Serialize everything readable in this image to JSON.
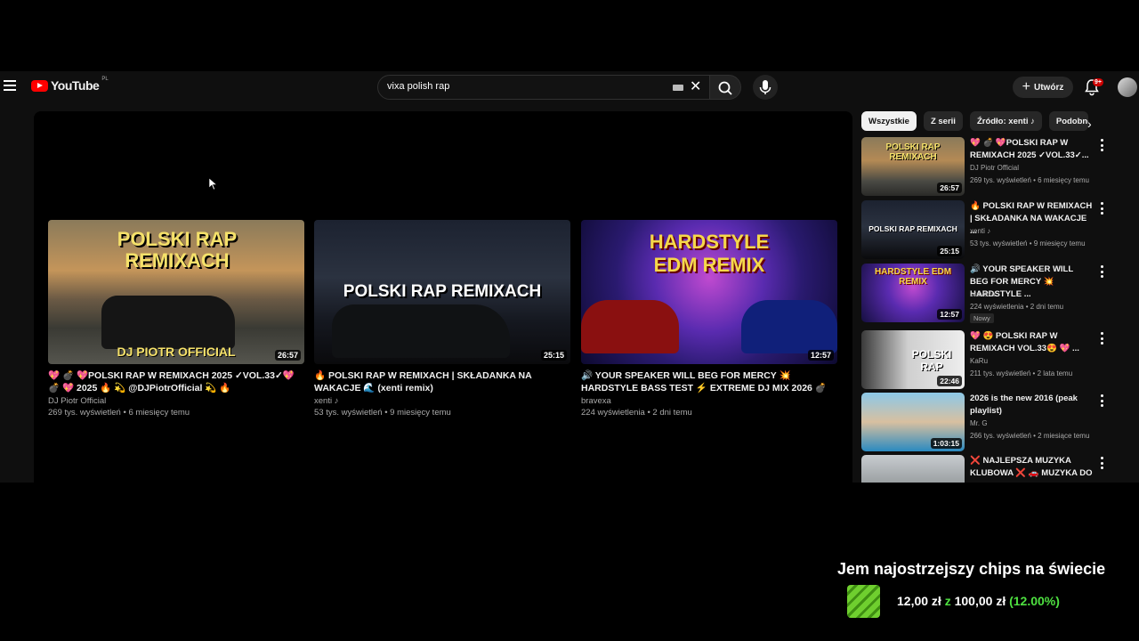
{
  "header": {
    "logo_text": "YouTube",
    "region": "PL",
    "search_value": "vixa polish rap",
    "create_label": "Utwórz",
    "notifications_badge": "9+"
  },
  "end_cards": [
    {
      "thumb_text": "POLSKI RAP REMIXACH",
      "thumb_sub": "DJ PIOTR OFFICIAL",
      "duration": "26:57",
      "title": "💖 💣 💖POLSKI RAP W REMIXACH 2025 ✓VOL.33✓💖 💣 💖 2025 🔥 💫 @DJPiotrOfficial 💫 🔥",
      "channel": "DJ Piotr Official",
      "meta": "269 tys. wyświetleń • 6 miesięcy temu"
    },
    {
      "thumb_text": "POLSKI RAP REMIXACH",
      "duration": "25:15",
      "title": "🔥 POLSKI RAP W REMIXACH | SKŁADANKA NA WAKACJE 🌊 (xenti remix)",
      "channel": "xenti ♪",
      "meta": "53 tys. wyświetleń • 9 miesięcy temu"
    },
    {
      "thumb_text": "HARDSTYLE EDM REMIX",
      "duration": "12:57",
      "title": "🔊 YOUR SPEAKER WILL BEG FOR MERCY 💥 HARDSTYLE BASS TEST ⚡ EXTREME DJ MIX 2026 💣",
      "channel": "bravexa",
      "meta": "224 wyświetlenia • 2 dni temu"
    }
  ],
  "chips": [
    "Wszystkie",
    "Z serii",
    "Źródło: xenti ♪",
    "Podobne"
  ],
  "recommendations": [
    {
      "title": "💖 💣 💖POLSKI RAP W REMIXACH 2025 ✓VOL.33✓...",
      "channel": "DJ Piotr Official",
      "meta": "269 tys. wyświetleń • 6 miesięcy temu",
      "duration": "26:57",
      "thumb_text": "POLSKI RAP REMIXACH"
    },
    {
      "title": "🔥 POLSKI RAP W REMIXACH | SKŁADANKA NA WAKACJE ...",
      "channel": "xenti ♪",
      "meta": "53 tys. wyświetleń • 9 miesięcy temu",
      "duration": "25:15",
      "thumb_text": "POLSKI RAP REMIXACH"
    },
    {
      "title": "🔊 YOUR SPEAKER WILL BEG FOR MERCY 💥 HARDSTYLE ...",
      "channel": "bravexa",
      "meta": "224 wyświetlenia • 2 dni temu",
      "duration": "12:57",
      "badge": "Nowy",
      "thumb_text": "HARDSTYLE EDM REMIX"
    },
    {
      "title": "💖 😍 POLSKI RAP W REMIXACH VOL.33😍 💖 ...",
      "channel": "KaRu",
      "meta": "211 tys. wyświetleń • 2 lata temu",
      "duration": "22:46",
      "thumb_text": "POLSKI RAP"
    },
    {
      "title": "2026 is the new 2016 (peak playlist)",
      "channel": "Mr. G",
      "meta": "266 tys. wyświetleń • 2 miesiące temu",
      "duration": "1:03:15"
    },
    {
      "title": "❌ NAJLEPSZA MUZYKA KLUBOWA ❌ 🚗 MUZYKA DO ..."
    }
  ],
  "overlay": {
    "title": "Jem najostrzejszy chips na świecie",
    "amount": "12,00 zł",
    "of_word": "z",
    "goal": "100,00 zł",
    "percent": "(12.00%)"
  },
  "colors": {
    "accent": "#ff0000",
    "progress_green": "#4ee040"
  }
}
